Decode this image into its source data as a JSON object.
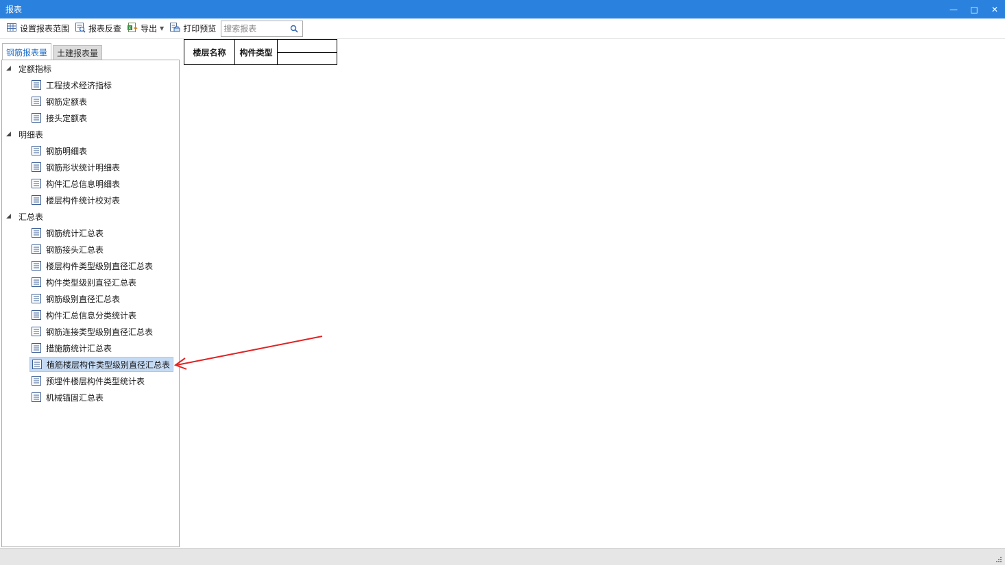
{
  "window": {
    "title": "报表",
    "controls": {
      "minimize": "—",
      "maximize": "□",
      "close": "✕"
    }
  },
  "toolbar": {
    "set_range": "设置报表范围",
    "reverse_check": "报表反查",
    "export": "导出",
    "print_preview": "打印预览",
    "search_placeholder": "搜索报表"
  },
  "tabs": [
    {
      "label": "钢筋报表量",
      "active": true
    },
    {
      "label": "土建报表量",
      "active": false
    }
  ],
  "tree": {
    "groups": [
      {
        "label": "定额指标",
        "items": [
          "工程技术经济指标",
          "钢筋定额表",
          "接头定额表"
        ]
      },
      {
        "label": "明细表",
        "items": [
          "钢筋明细表",
          "钢筋形状统计明细表",
          "构件汇总信息明细表",
          "楼层构件统计校对表"
        ]
      },
      {
        "label": "汇总表",
        "items": [
          "钢筋统计汇总表",
          "钢筋接头汇总表",
          "楼层构件类型级别直径汇总表",
          "构件类型级别直径汇总表",
          "钢筋级别直径汇总表",
          "构件汇总信息分类统计表",
          "钢筋连接类型级别直径汇总表",
          "措施筋统计汇总表",
          "植筋楼层构件类型级别直径汇总表",
          "预埋件楼层构件类型统计表",
          "机械锚固汇总表"
        ]
      }
    ],
    "selected": "植筋楼层构件类型级别直径汇总表"
  },
  "report": {
    "headers": [
      "楼层名称",
      "构件类型"
    ]
  },
  "colors": {
    "titlebar": "#2b82de",
    "selected_bg": "#c5dbf5",
    "annotation_arrow": "#e02424",
    "active_tab_text": "#1e6fc9"
  }
}
